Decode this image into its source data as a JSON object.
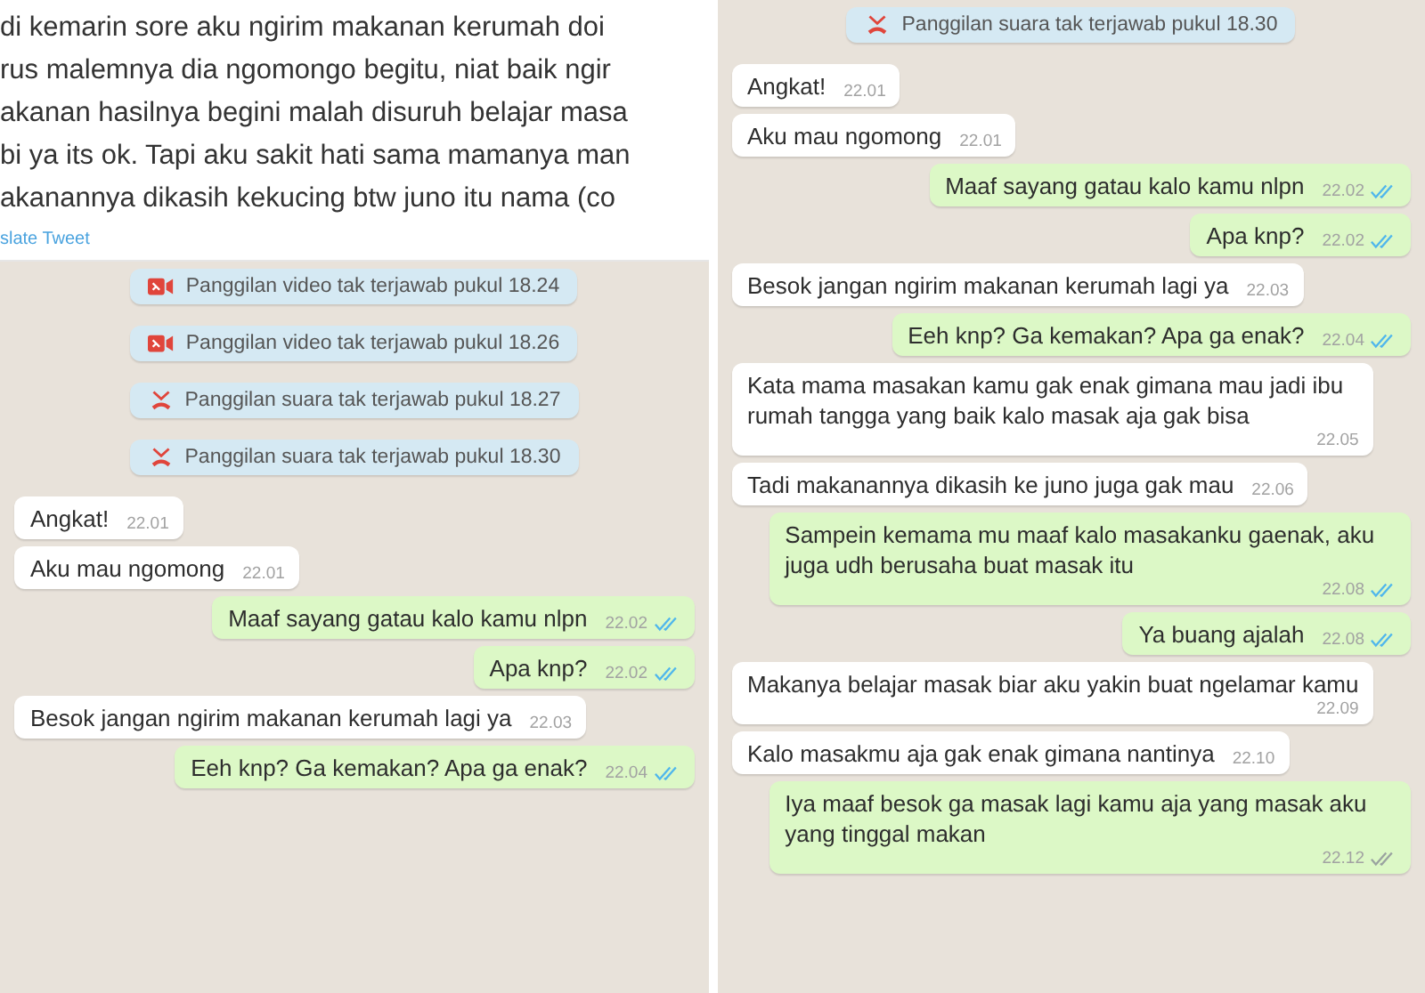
{
  "panels": [
    {
      "tweet": {
        "lines": [
          "di kemarin sore aku ngirim makanan kerumah doi",
          "rus malemnya dia ngomongo begitu, niat baik ngir",
          "akanan hasilnya begini malah disuruh belajar masa",
          "bi ya its ok. Tapi aku sakit hati sama mamanya man",
          "akanannya dikasih kekucing btw juno itu nama (co"
        ],
        "link": "slate Tweet"
      },
      "calls": [
        {
          "kind": "video",
          "text": "Panggilan video tak terjawab pukul 18.24"
        },
        {
          "kind": "video",
          "text": "Panggilan video tak terjawab pukul 18.26"
        },
        {
          "kind": "voice",
          "text": "Panggilan suara tak terjawab pukul 18.27"
        },
        {
          "kind": "voice",
          "text": "Panggilan suara tak terjawab pukul 18.30"
        }
      ],
      "messages": [
        {
          "kind": "incoming",
          "text": "Angkat!",
          "time": "22.01"
        },
        {
          "kind": "incoming",
          "text": "Aku mau ngomong",
          "time": "22.01"
        },
        {
          "kind": "outgoing",
          "text": "Maaf sayang gatau kalo kamu nlpn",
          "time": "22.02",
          "read": true
        },
        {
          "kind": "outgoing",
          "text": "Apa knp?",
          "time": "22.02",
          "read": true
        },
        {
          "kind": "incoming",
          "text": "Besok jangan ngirim makanan kerumah lagi ya",
          "time": "22.03"
        },
        {
          "kind": "outgoing",
          "text": "Eeh knp? Ga kemakan? Apa ga enak?",
          "time": "22.04",
          "read": true
        }
      ]
    },
    {
      "calls": [
        {
          "kind": "voice",
          "text": "Panggilan suara tak terjawab pukul 18.30"
        }
      ],
      "messages": [
        {
          "kind": "incoming",
          "text": "Angkat!",
          "time": "22.01"
        },
        {
          "kind": "incoming",
          "text": "Aku mau ngomong",
          "time": "22.01"
        },
        {
          "kind": "outgoing",
          "text": "Maaf sayang gatau kalo kamu nlpn",
          "time": "22.02",
          "read": true
        },
        {
          "kind": "outgoing",
          "text": "Apa knp?",
          "time": "22.02",
          "read": true
        },
        {
          "kind": "incoming",
          "text": "Besok jangan ngirim makanan kerumah lagi ya",
          "time": "22.03"
        },
        {
          "kind": "outgoing",
          "text": "Eeh knp? Ga kemakan? Apa ga enak?",
          "time": "22.04",
          "read": true
        },
        {
          "kind": "incoming",
          "text": "Kata mama masakan kamu gak enak gimana mau jadi ibu rumah tangga yang baik kalo masak aja gak bisa",
          "time": "22.05"
        },
        {
          "kind": "incoming",
          "text": "Tadi makanannya dikasih ke juno juga gak mau",
          "time": "22.06"
        },
        {
          "kind": "outgoing",
          "text": "Sampein kemama mu maaf kalo masakanku gaenak, aku juga udh berusaha buat masak itu",
          "time": "22.08",
          "read": true
        },
        {
          "kind": "outgoing",
          "text": "Ya buang ajalah",
          "time": "22.08",
          "read": true
        },
        {
          "kind": "incoming",
          "text": "Makanya belajar masak biar aku yakin buat ngelamar kamu",
          "time": "22.09"
        },
        {
          "kind": "incoming",
          "text": "Kalo masakmu aja gak enak gimana nantinya",
          "time": "22.10"
        },
        {
          "kind": "outgoing",
          "text": "Iya maaf besok ga masak lagi kamu aja yang masak aku yang tinggal makan",
          "time": "22.12",
          "read": false
        }
      ]
    }
  ]
}
